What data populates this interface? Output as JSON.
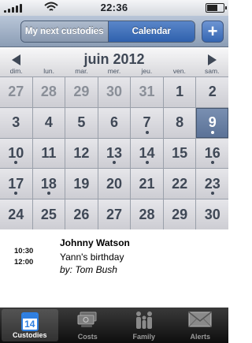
{
  "status_bar": {
    "time": "22:36"
  },
  "nav": {
    "segments": [
      {
        "label": "My next custodies",
        "selected": false
      },
      {
        "label": "Calendar",
        "selected": true
      }
    ],
    "add_label": "+"
  },
  "calendar": {
    "month_title": "juin 2012",
    "weekdays": [
      "dim.",
      "lun.",
      "mar.",
      "mer.",
      "jeu.",
      "ven.",
      "sam."
    ],
    "weeks": [
      [
        {
          "d": "27",
          "other": true
        },
        {
          "d": "28",
          "other": true
        },
        {
          "d": "29",
          "other": true
        },
        {
          "d": "30",
          "other": true
        },
        {
          "d": "31",
          "other": true
        },
        {
          "d": "1"
        },
        {
          "d": "2"
        }
      ],
      [
        {
          "d": "3"
        },
        {
          "d": "4"
        },
        {
          "d": "5"
        },
        {
          "d": "6"
        },
        {
          "d": "7",
          "dot": true
        },
        {
          "d": "8"
        },
        {
          "d": "9",
          "dot": true,
          "selected": true
        }
      ],
      [
        {
          "d": "10",
          "dot": true
        },
        {
          "d": "11"
        },
        {
          "d": "12"
        },
        {
          "d": "13",
          "dot": true
        },
        {
          "d": "14",
          "dot": true
        },
        {
          "d": "15"
        },
        {
          "d": "16",
          "dot": true
        }
      ],
      [
        {
          "d": "17",
          "dot": true
        },
        {
          "d": "18",
          "dot": true
        },
        {
          "d": "19"
        },
        {
          "d": "20"
        },
        {
          "d": "21"
        },
        {
          "d": "22"
        },
        {
          "d": "23",
          "dot": true
        }
      ],
      [
        {
          "d": "24"
        },
        {
          "d": "25"
        },
        {
          "d": "26"
        },
        {
          "d": "27"
        },
        {
          "d": "28"
        },
        {
          "d": "29"
        },
        {
          "d": "30"
        }
      ]
    ]
  },
  "events": [
    {
      "start": "10:30",
      "end": "12:00",
      "name": "Johnny  Watson",
      "title": "Yann's birthday",
      "by": "by: Tom Bush"
    }
  ],
  "tabbar": {
    "tabs": [
      {
        "label": "Custodies",
        "icon": "calendar-icon",
        "badge": "14",
        "active": true
      },
      {
        "label": "Costs",
        "icon": "money-icon",
        "active": false
      },
      {
        "label": "Family",
        "icon": "family-icon",
        "active": false
      },
      {
        "label": "Alerts",
        "icon": "envelope-icon",
        "active": false
      }
    ]
  }
}
